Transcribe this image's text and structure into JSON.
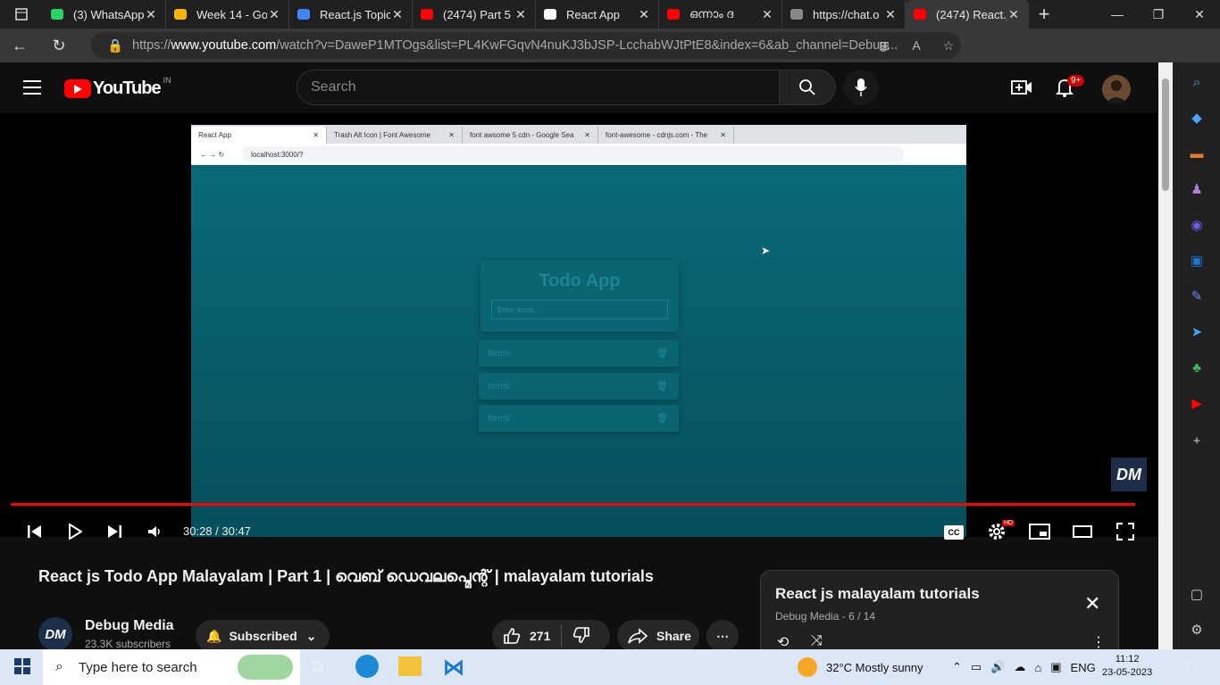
{
  "browser": {
    "tabs": [
      {
        "title": "(3) WhatsApp",
        "icon": "whatsapp-icon",
        "color": "#25d366"
      },
      {
        "title": "Week 14 - Go",
        "icon": "drive-icon",
        "color": "#f4b400"
      },
      {
        "title": "React.js Topic",
        "icon": "docs-icon",
        "color": "#4285f4"
      },
      {
        "title": "(2474) Part 5",
        "icon": "youtube-icon",
        "color": "#ff0000"
      },
      {
        "title": "React App",
        "icon": "page-icon",
        "color": "#ffffff"
      },
      {
        "title": "ഒന്നാം ദ",
        "icon": "youtube-icon",
        "color": "#ff0000"
      },
      {
        "title": "https://chat.o",
        "icon": "chatgpt-icon",
        "color": "#888888"
      },
      {
        "title": "(2474) React.j",
        "icon": "youtube-icon",
        "color": "#ff0000",
        "active": true
      }
    ],
    "url_prefix": "https://",
    "url_host": "www.youtube.com",
    "url_rest": "/watch?v=DaweP1MTOgs&list=PL4KwFGqvN4nuKJ3bJSP-LcchabWJtPtE8&index=6&ab_channel=Debug..."
  },
  "youtube": {
    "logo_text": "YouTube",
    "region": "IN",
    "search_placeholder": "Search",
    "notifications": "9+"
  },
  "video": {
    "inner_tabs": [
      {
        "title": "React App"
      },
      {
        "title": "Trash Alt Icon | Font Awesome"
      },
      {
        "title": "font awsome 5 cdn - Google Sea"
      },
      {
        "title": "font-awesome - cdnjs.com - The"
      }
    ],
    "inner_url": "localhost:3000/?",
    "todo_title": "Todo App",
    "todo_placeholder": "Enter Items...",
    "items": [
      "Items",
      "Items",
      "Items"
    ],
    "watermark": "DM",
    "time": "30:28 / 30:47",
    "cc": "CC",
    "hd": "HD",
    "progress": 0.99
  },
  "meta": {
    "title": "React js Todo App Malayalam | Part 1 | വെബ് ഡെവലപ്മെന്റ് | malayalam tutorials",
    "channel": "Debug Media",
    "subscribers": "23.3K subscribers",
    "subscribed_label": "Subscribed",
    "likes": "271",
    "share_label": "Share"
  },
  "playlist": {
    "title": "React js malayalam tutorials",
    "channel": "Debug Media",
    "position": "6 / 14"
  },
  "taskbar": {
    "search_placeholder": "Type here to search",
    "weather": "32°C  Mostly sunny",
    "lang": "ENG",
    "time": "11:12",
    "date": "23-05-2023"
  }
}
